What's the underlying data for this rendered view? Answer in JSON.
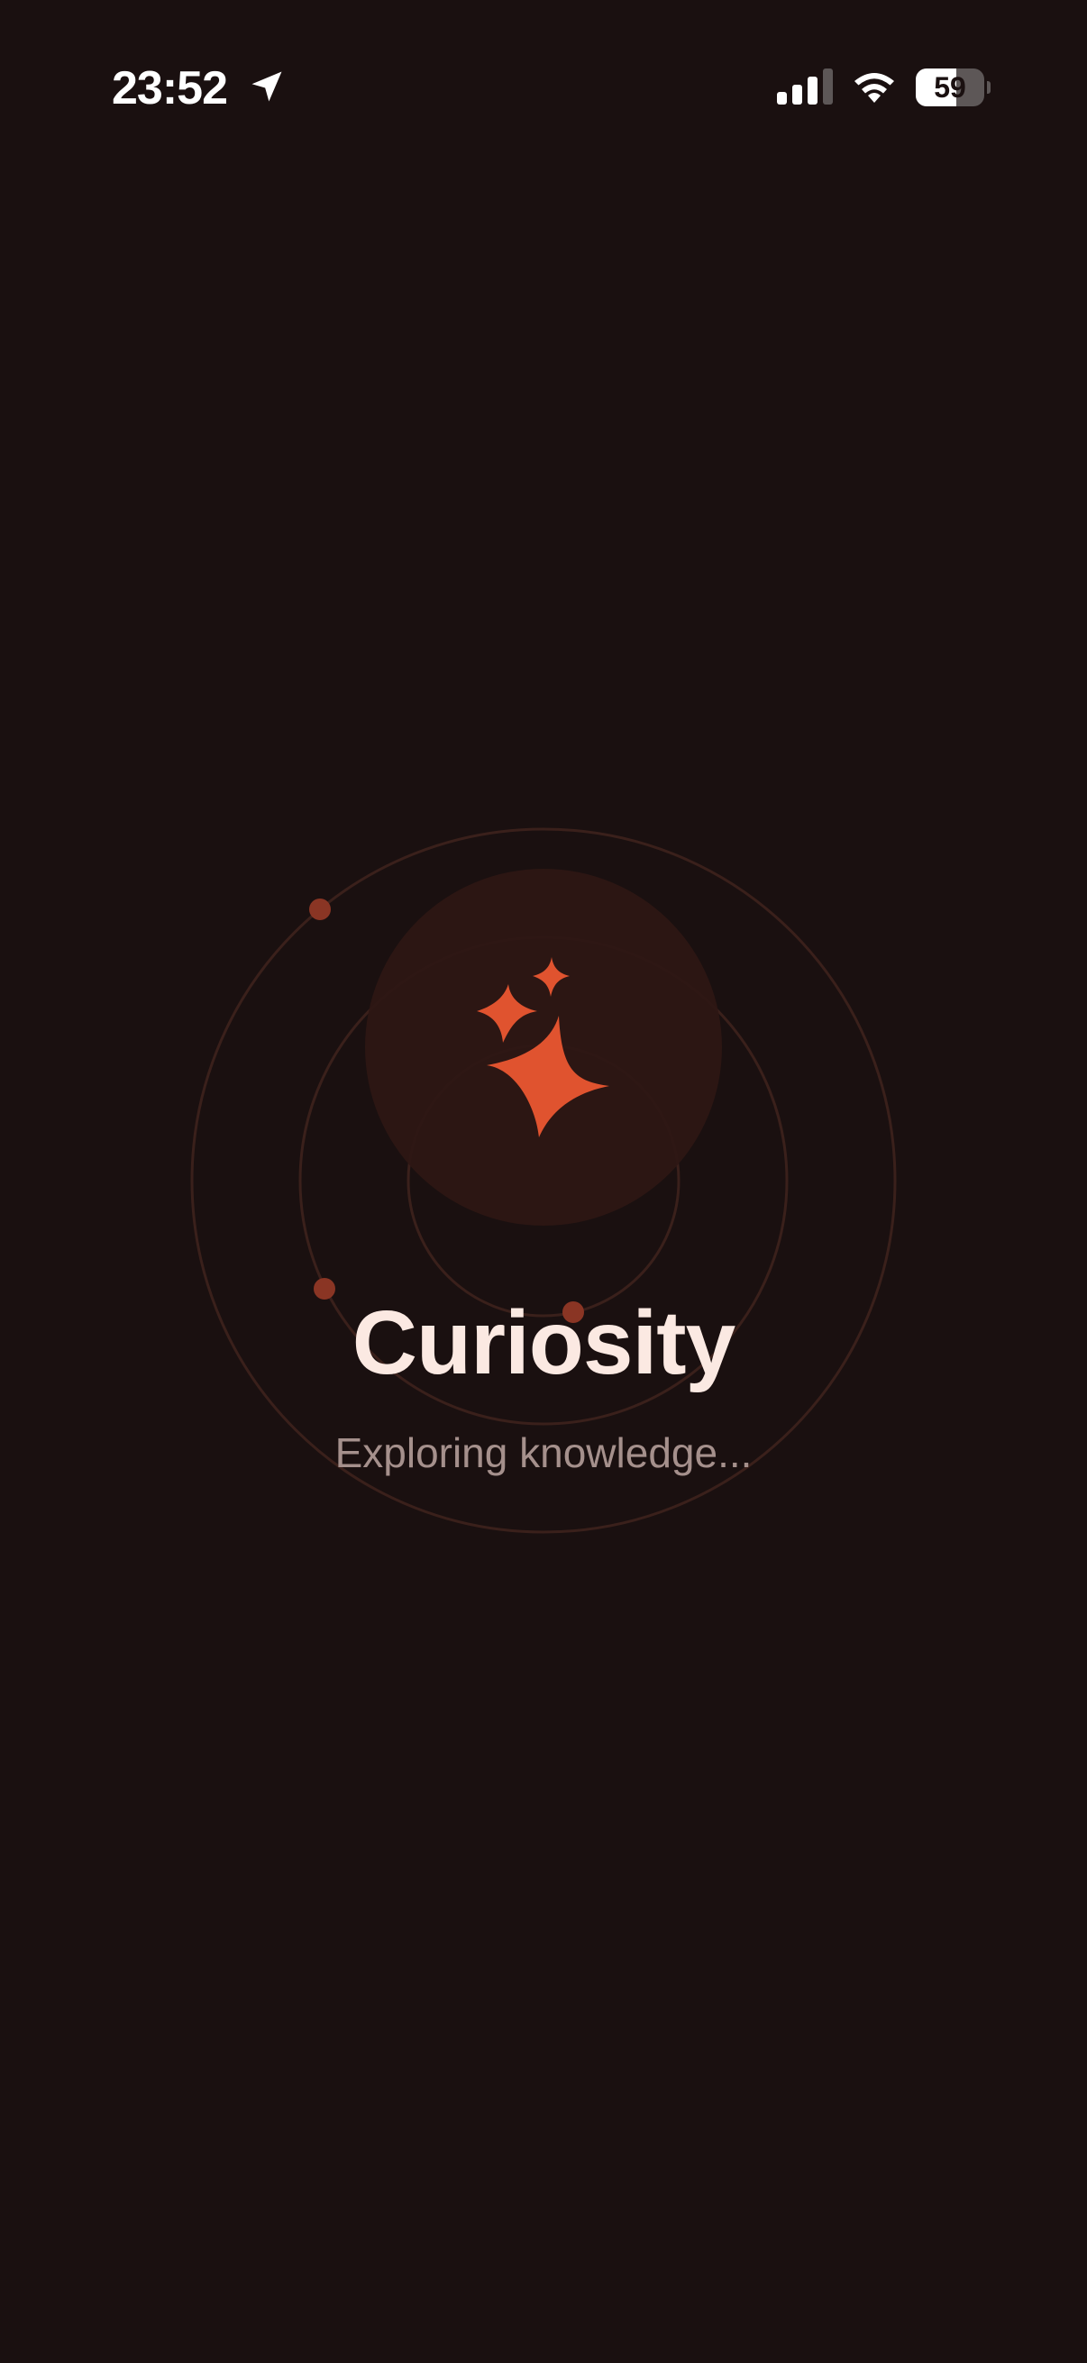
{
  "status_bar": {
    "time": "23:52",
    "battery_level": 59,
    "battery_label": "59",
    "icons": [
      "location-arrow-icon",
      "cellular-signal-icon",
      "wifi-icon",
      "battery-icon"
    ]
  },
  "splash": {
    "title": "Curiosity",
    "subtitle": "Exploring knowledge...",
    "logo_icon": "sparkles-icon"
  },
  "colors": {
    "background": "#1a1010",
    "accent": "#e0532f",
    "title": "#fbe9e2",
    "subtitle": "#a5908c",
    "orbit_ring": "#3a201b",
    "glow": "#2e1714",
    "orbit_dot": "#8a3524"
  }
}
